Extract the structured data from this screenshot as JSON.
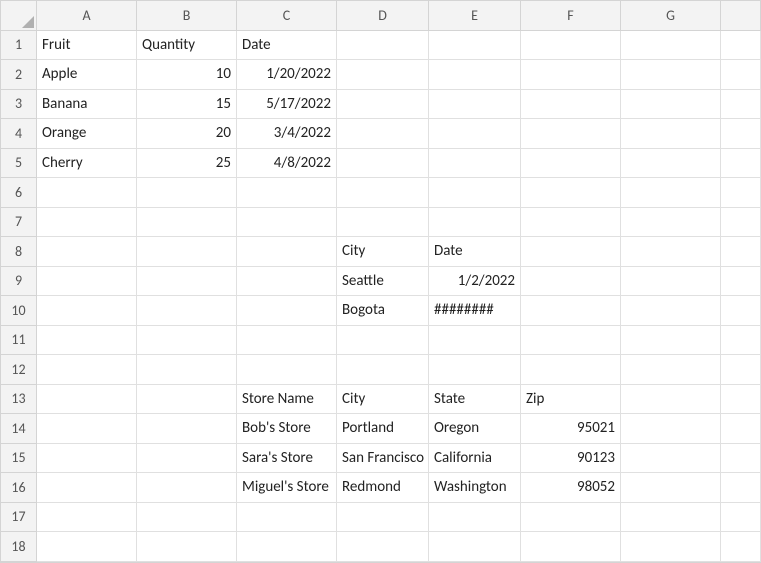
{
  "columns": [
    "A",
    "B",
    "C",
    "D",
    "E",
    "F",
    "G"
  ],
  "rowCount": 18,
  "cells": {
    "A1": "Fruit",
    "B1": "Quantity",
    "C1": "Date",
    "A2": "Apple",
    "B2": "10",
    "C2": "1/20/2022",
    "A3": "Banana",
    "B3": "15",
    "C3": "5/17/2022",
    "A4": "Orange",
    "B4": "20",
    "C4": "3/4/2022",
    "A5": "Cherry",
    "B5": "25",
    "C5": "4/8/2022",
    "D8": "City",
    "E8": "Date",
    "D9": "Seattle",
    "E9": "1/2/2022",
    "D10": "Bogota",
    "E10": "########",
    "C13": "Store Name",
    "D13": "City",
    "E13": "State",
    "F13": "Zip",
    "C14": "Bob's Store",
    "D14": "Portland",
    "E14": "Oregon",
    "F14": "95021",
    "C15": "Sara's Store",
    "D15": "San Francisco",
    "E15": "California",
    "F15": "90123",
    "C16": "Miguel's Store",
    "D16": "Redmond",
    "E16": "Washington",
    "F16": "98052"
  },
  "rightAligned": [
    "B2",
    "B3",
    "B4",
    "B5",
    "C2",
    "C3",
    "C4",
    "C5",
    "E9",
    "F14",
    "F15",
    "F16"
  ],
  "chart_data": [
    {
      "type": "table",
      "title": "Fruit Quantity",
      "columns": [
        "Fruit",
        "Quantity",
        "Date"
      ],
      "rows": [
        [
          "Apple",
          10,
          "1/20/2022"
        ],
        [
          "Banana",
          15,
          "5/17/2022"
        ],
        [
          "Orange",
          20,
          "3/4/2022"
        ],
        [
          "Cherry",
          25,
          "4/8/2022"
        ]
      ]
    },
    {
      "type": "table",
      "title": "City Date",
      "columns": [
        "City",
        "Date"
      ],
      "rows": [
        [
          "Seattle",
          "1/2/2022"
        ],
        [
          "Bogota",
          "########"
        ]
      ]
    },
    {
      "type": "table",
      "title": "Stores",
      "columns": [
        "Store Name",
        "City",
        "State",
        "Zip"
      ],
      "rows": [
        [
          "Bob's Store",
          "Portland",
          "Oregon",
          95021
        ],
        [
          "Sara's Store",
          "San Francisco",
          "California",
          90123
        ],
        [
          "Miguel's Store",
          "Redmond",
          "Washington",
          98052
        ]
      ]
    }
  ]
}
